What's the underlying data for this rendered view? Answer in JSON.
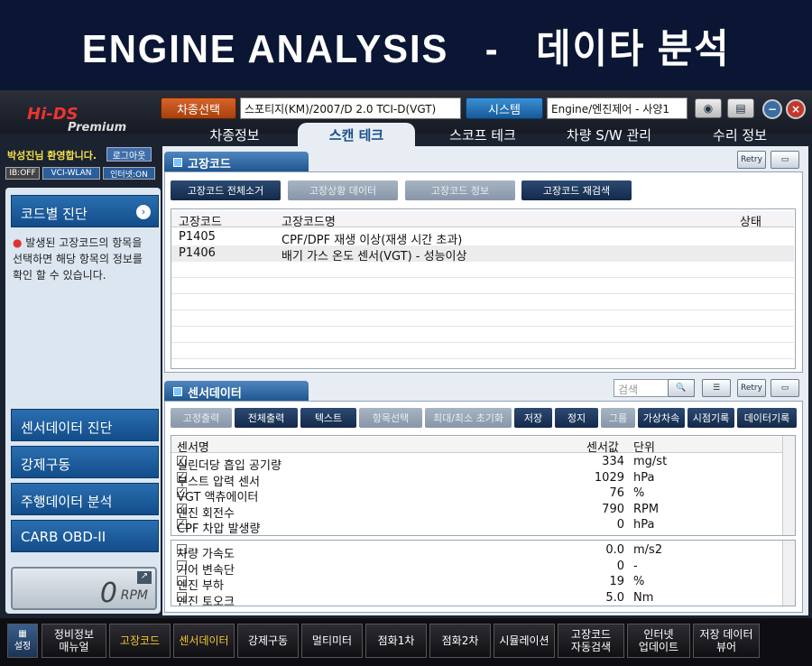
{
  "banner": "ENGINE ANALYSIS   -   데이타 분석",
  "logo": {
    "brand": "Hi-DS",
    "sub": "Premium"
  },
  "top": {
    "vehicle_btn": "차종선택",
    "vehicle_value": "스포티지(KM)/2007/D 2.0 TCI-D(VGT)",
    "system_btn": "시스템",
    "system_value": "Engine/엔진제어 - 사양1"
  },
  "tabs": [
    "차종정보",
    "스캔 테크",
    "스코프 테크",
    "차량 S/W 관리",
    "수리 정보"
  ],
  "left": {
    "welcome": "박성진님 환영합니다.",
    "logout": "로그아웃",
    "status": [
      "IB:OFF",
      "VCI-WLAN",
      "인터넷:ON"
    ],
    "code_diag": "코드별 진단",
    "hint": "발생된 고장코드의 항목을 선택하면 해당 항목의 정보를 확인 할 수 있습니다.",
    "nav": [
      "센서데이터 진단",
      "강제구동",
      "주행데이터 분석",
      "CARB OBD-II"
    ],
    "rpm": "0",
    "rpm_unit": "RPM"
  },
  "dtc": {
    "title": "고장코드",
    "retry": "Retry",
    "buttons": [
      "고장코드 전체소거",
      "고장상황 데이터",
      "고장코드 정보",
      "고장코드 재검색"
    ],
    "headers": [
      "고장코드",
      "고장코드명",
      "상태"
    ],
    "rows": [
      {
        "code": "P1405",
        "name": "CPF/DPF 재생 이상(재생 시간 초과)"
      },
      {
        "code": "P1406",
        "name": "배기 가스 온도 센서(VGT) - 성능이상"
      }
    ]
  },
  "sensor": {
    "title": "센서데이터",
    "search_placeholder": "검색",
    "retry": "Retry",
    "toolbar": [
      "고정출력",
      "전체출력",
      "텍스트",
      "항목선택",
      "최대/최소 초기화",
      "저장",
      "정지",
      "그룹",
      "가상차속",
      "시점기록",
      "데이터기록"
    ],
    "headers": [
      "센서명",
      "센서값",
      "단위"
    ],
    "top_rows": [
      {
        "name": "실린더당 흡입 공기량",
        "value": "334",
        "unit": "mg/st"
      },
      {
        "name": "부스트 압력 센서",
        "value": "1029",
        "unit": "hPa"
      },
      {
        "name": "VGT 액츄에이터",
        "value": "76",
        "unit": "%"
      },
      {
        "name": "엔진 회전수",
        "value": "790",
        "unit": "RPM"
      },
      {
        "name": "CPF 차압 발생량",
        "value": "0",
        "unit": "hPa"
      }
    ],
    "bottom_rows": [
      {
        "name": "차량 가속도",
        "value": "0.0",
        "unit": "m/s2"
      },
      {
        "name": "기어 변속단",
        "value": "0",
        "unit": "-"
      },
      {
        "name": "엔진 부하",
        "value": "19",
        "unit": "%"
      },
      {
        "name": "엔진 토오크",
        "value": "5.0",
        "unit": "Nm"
      }
    ]
  },
  "bottombar": [
    "설정",
    "정비정보\n매뉴얼",
    "고장코드",
    "센서데이터",
    "강제구동",
    "멀티미터",
    "점화1차",
    "점화2차",
    "시뮬레이션",
    "고장코드\n자동검색",
    "인터넷\n업데이트",
    "저장 데이터\n뷰어"
  ]
}
